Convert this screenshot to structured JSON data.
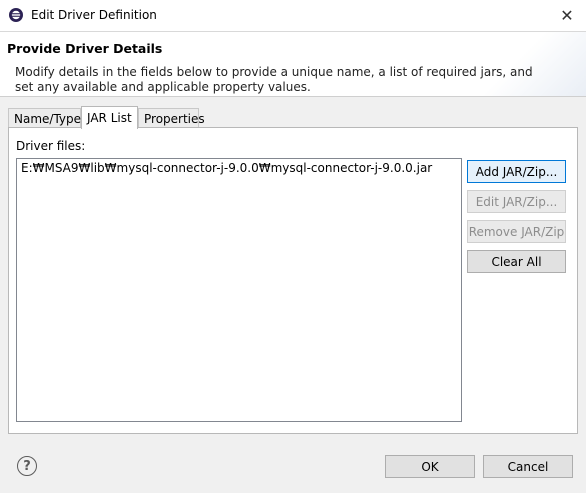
{
  "window": {
    "title": "Edit Driver Definition",
    "close_glyph": "✕"
  },
  "header": {
    "title": "Provide Driver Details",
    "description": "Modify details in the fields below to provide a unique name, a list of required jars, and set any available and applicable property values."
  },
  "tabs": [
    "Name/Type",
    "JAR List",
    "Properties"
  ],
  "active_tab": "JAR List",
  "jar_list": {
    "label": "Driver files:",
    "files": [
      "E:₩MSA9₩lib₩mysql-connector-j-9.0.0₩mysql-connector-j-9.0.0.jar"
    ],
    "buttons": {
      "add": "Add JAR/Zip...",
      "edit": "Edit JAR/Zip...",
      "remove": "Remove JAR/Zip",
      "clear": "Clear All"
    }
  },
  "footer": {
    "help_glyph": "?",
    "ok": "OK",
    "cancel": "Cancel"
  },
  "icons": {
    "app": "eclipse-app-icon",
    "close": "close-icon",
    "help": "help-icon"
  },
  "colors": {
    "focus_border": "#0078d7",
    "focus_fill": "#e5f1fb",
    "disabled_text": "#8d8d8d"
  }
}
